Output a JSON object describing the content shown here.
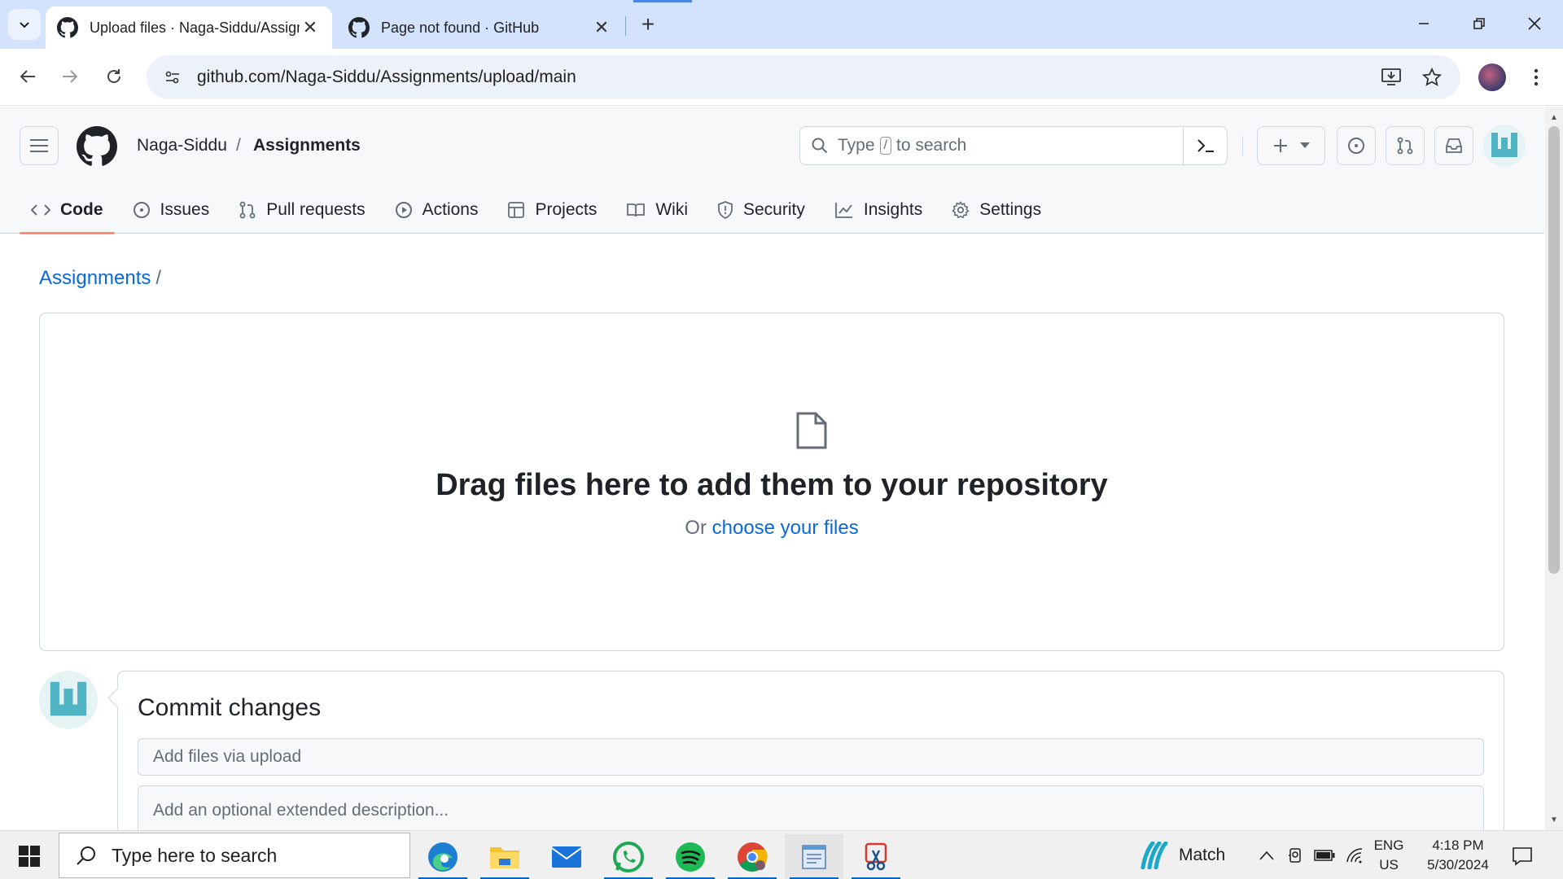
{
  "browser": {
    "tabs": [
      {
        "title": "Upload files · Naga-Siddu/Assignments",
        "active": true
      },
      {
        "title": "Page not found · GitHub",
        "active": false
      }
    ],
    "url": "github.com/Naga-Siddu/Assignments/upload/main"
  },
  "github": {
    "owner": "Naga-Siddu",
    "separator": "/",
    "repo": "Assignments",
    "search": {
      "type_word": "Type",
      "key": "/",
      "suffix": "to search"
    },
    "repo_nav": [
      {
        "label": "Code",
        "icon": "code-icon",
        "selected": true
      },
      {
        "label": "Issues",
        "icon": "issue-icon",
        "selected": false
      },
      {
        "label": "Pull requests",
        "icon": "pull-request-icon",
        "selected": false
      },
      {
        "label": "Actions",
        "icon": "play-icon",
        "selected": false
      },
      {
        "label": "Projects",
        "icon": "table-icon",
        "selected": false
      },
      {
        "label": "Wiki",
        "icon": "book-icon",
        "selected": false
      },
      {
        "label": "Security",
        "icon": "shield-icon",
        "selected": false
      },
      {
        "label": "Insights",
        "icon": "graph-icon",
        "selected": false
      },
      {
        "label": "Settings",
        "icon": "gear-icon",
        "selected": false
      }
    ]
  },
  "upload": {
    "breadcrumb_repo": "Assignments",
    "breadcrumb_sep": "/",
    "drop_title": "Drag files here to add them to your repository",
    "drop_prefix": "Or",
    "drop_link": "choose your files"
  },
  "commit": {
    "title": "Commit changes",
    "summary_placeholder": "Add files via upload",
    "description_placeholder": "Add an optional extended description..."
  },
  "taskbar": {
    "search_placeholder": "Type here to search",
    "weather_label": "Match",
    "lang_line1": "ENG",
    "lang_line2": "US",
    "time": "4:18 PM",
    "date": "5/30/2024"
  },
  "colors": {
    "link": "#0969da",
    "tab_underline": "#fd8c73",
    "tabstrip": "#d3e3fd"
  }
}
